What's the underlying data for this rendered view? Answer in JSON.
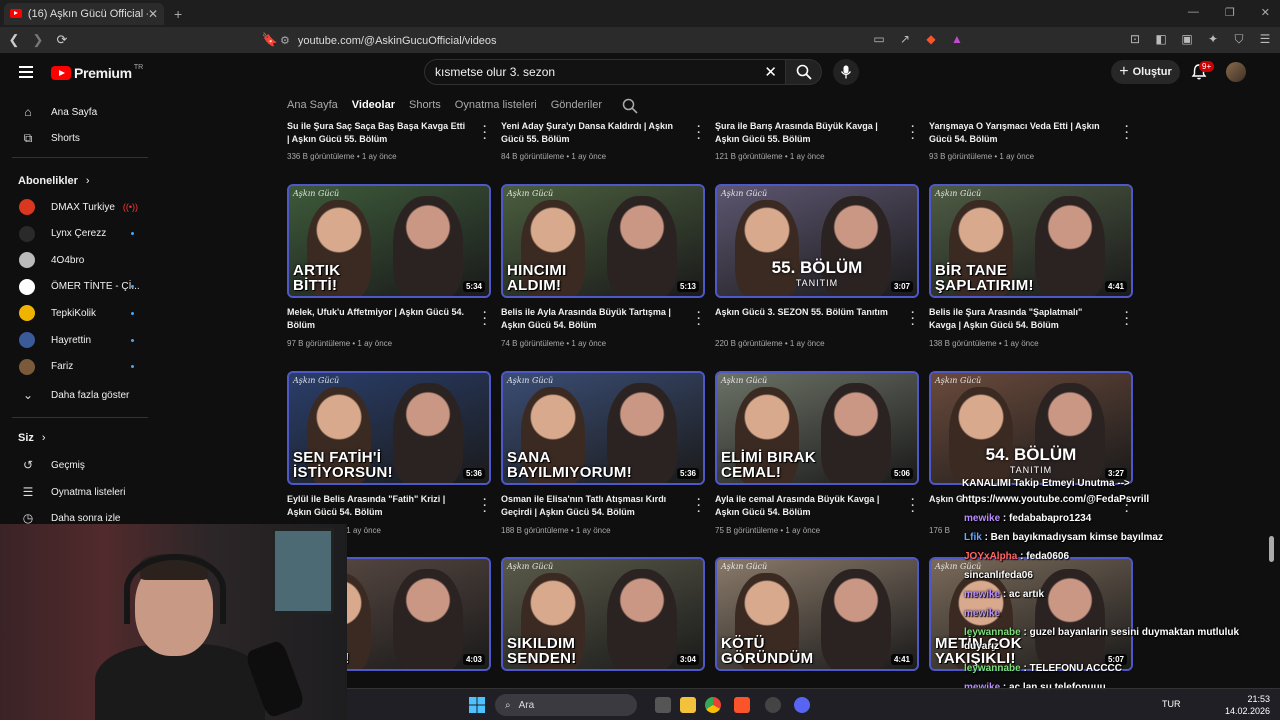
{
  "browser": {
    "tab_title": "(16) Aşkın Gücü Official - YouTube",
    "url": "youtube.com/@AskinGucuOfficial/videos"
  },
  "masthead": {
    "logo_text": "Premium",
    "logo_sup": "TR",
    "search_value": "kısmetse olur 3. sezon",
    "create_label": "Oluştur",
    "notif_badge": "9+"
  },
  "sidebar": {
    "home": "Ana Sayfa",
    "shorts": "Shorts",
    "subs_header": "Abonelikler",
    "subs": [
      {
        "name": "DMAX Turkiye",
        "color": "#d9371f"
      },
      {
        "name": "Lynx Çerezz",
        "color": "#2a2a2a"
      },
      {
        "name": "4O4bro",
        "color": "#bbbbbb"
      },
      {
        "name": "ÖMER TİNTE - Çİ...",
        "color": "#ffffff"
      },
      {
        "name": "TepkiKolik",
        "color": "#f0b400"
      },
      {
        "name": "Hayrettin",
        "color": "#3a5a9a"
      },
      {
        "name": "Fariz",
        "color": "#7a5a3a"
      }
    ],
    "show_more": "Daha fazla göster",
    "you_header": "Siz",
    "history": "Geçmiş",
    "playlists": "Oynatma listeleri",
    "watch_later": "Daha sonra izle"
  },
  "channel_tabs": [
    "Ana Sayfa",
    "Videolar",
    "Shorts",
    "Oynatma listeleri",
    "Gönderiler"
  ],
  "top_row": [
    {
      "title": "Su ile Şura Saç Saça Baş Başa Kavga Etti | Aşkın Gücü 55. Bölüm",
      "meta": "336 B görüntüleme • 1 ay önce"
    },
    {
      "title": "Yeni Aday Şura'yı Dansa Kaldırdı | Aşkın Gücü 55. Bölüm",
      "meta": "84 B görüntüleme • 1 ay önce"
    },
    {
      "title": "Şura ile Barış Arasında Büyük Kavga | Aşkın Gücü 55. Bölüm",
      "meta": "121 B görüntüleme • 1 ay önce"
    },
    {
      "title": "Yarışmaya O Yarışmacı Veda Etti | Aşkın Gücü 54. Bölüm",
      "meta": "93 B görüntüleme • 1 ay önce"
    }
  ],
  "videos": [
    {
      "caption": "ARTIK\nBİTTİ!",
      "duration": "5:34",
      "title": "Melek, Ufuk'u Affetmiyor | Aşkın Gücü 54. Bölüm",
      "meta": "97 B görüntüleme • 1 ay önce",
      "bg": "#3d5a3a"
    },
    {
      "caption": "HINCIMI\nALDIM!",
      "duration": "5:13",
      "title": "Belis ile Ayla Arasında Büyük Tartışma | Aşkın Gücü 54. Bölüm",
      "meta": "74 B görüntüleme • 1 ay önce",
      "bg": "#4a5e3e"
    },
    {
      "caption": "",
      "bolum": "55. BÖLÜM",
      "bolum_sub": "TANITIM",
      "duration": "3:07",
      "title": "Aşkın Gücü 3. SEZON 55. Bölüm Tanıtım",
      "meta": "220 B görüntüleme • 1 ay önce",
      "bg": "#5d5670"
    },
    {
      "caption": "BİR TANE\nŞAPLATIRIM!",
      "duration": "4:41",
      "title": "Belis ile Şura Arasında \"Şaplatmalı\" Kavga | Aşkın Gücü 54. Bölüm",
      "meta": "138 B görüntüleme • 1 ay önce",
      "bg": "#4e5c44"
    },
    {
      "caption": "SEN FATİH'İ\nİSTİYORSUN!",
      "duration": "5:36",
      "title": "Eylül ile Belis Arasında \"Fatih\" Krizi | Aşkın Gücü 54. Bölüm",
      "meta": "B görüntüleme • 1 ay önce",
      "bg": "#2a3e6a"
    },
    {
      "caption": "SANA\nBAYILMIYORUM!",
      "duration": "5:36",
      "title": "Osman ile Elisa'nın Tatlı Atışması Kırdı Geçirdi | Aşkın Gücü 54. Bölüm",
      "meta": "188 B görüntüleme • 1 ay önce",
      "bg": "#3b4d74"
    },
    {
      "caption": "ELİMİ BIRAK\nCEMAL!",
      "duration": "5:06",
      "title": "Ayla ile cemal Arasında Büyük Kavga | Aşkın Gücü 54. Bölüm",
      "meta": "75 B görüntüleme • 1 ay önce",
      "bg": "#6c7266"
    },
    {
      "caption": "",
      "bolum": "54. BÖLÜM",
      "bolum_sub": "TANITIM",
      "duration": "3:27",
      "title": "Aşkın G",
      "meta": "176 B",
      "bg": "#6a4a3c"
    },
    {
      "caption": "...KTIM!",
      "duration": "4:03",
      "title": "",
      "meta": "",
      "bg": "#5a4a44"
    },
    {
      "caption": "SIKILDIM\nSENDEN!",
      "duration": "3:04",
      "title": "",
      "meta": "",
      "bg": "#5a5a4a"
    },
    {
      "caption": "KÖTÜ\nGÖRÜNDÜM",
      "duration": "4:41",
      "title": "",
      "meta": "",
      "bg": "#8a7a6a"
    },
    {
      "caption": "METİN ÇOK\nYAKIŞIKLI!",
      "duration": "5:07",
      "title": "",
      "meta": "",
      "bg": "#7a6a5a"
    }
  ],
  "brand_text": "Aşkın Gücü",
  "chat": [
    {
      "user": "",
      "text": "KANALIMI Takip Etmeyi Unutma -->"
    },
    {
      "user": "",
      "text": "https://www.youtube.com/@FedaPsvrill"
    },
    {
      "user": "mewike",
      "text": ": fedababapro1234"
    },
    {
      "user": "Lfik",
      "text": ": Ben bayıkmadıysam kimse bayılmaz"
    },
    {
      "user": "JOYxAlpha",
      "text": ": feda0606"
    },
    {
      "user": "",
      "text": "sincanlıfeda06"
    },
    {
      "user": "mewike",
      "text": ": ac artık"
    },
    {
      "user": "mewike",
      "text": ""
    },
    {
      "user": "leywannabe",
      "text": ": guzel bayanlarin sesini duymaktan mutluluk"
    },
    {
      "user": "",
      "text": "duyarız"
    },
    {
      "user": "leywannabe",
      "text": ": TELEFONU ACCCC"
    },
    {
      "user": "mewike",
      "text": ": ac lan su telefonuuu"
    }
  ],
  "taskbar": {
    "search_placeholder": "Ara",
    "lang": "TUR",
    "time": "21:53",
    "date": "14.02.2026"
  }
}
